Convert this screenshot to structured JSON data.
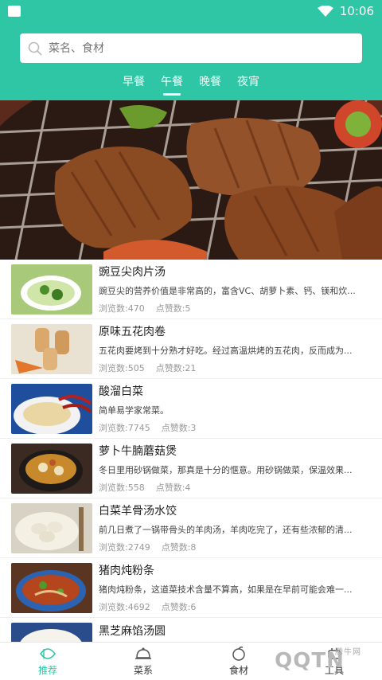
{
  "status": {
    "time": "10:06"
  },
  "search": {
    "placeholder": "菜名、食材"
  },
  "tabs": [
    "早餐",
    "午餐",
    "晚餐",
    "夜宵"
  ],
  "active_tab": "午餐",
  "banner": {
    "image": "grilled-steak-banner"
  },
  "items": [
    {
      "title": "豌豆尖肉片汤",
      "desc": "豌豆尖的营养价值是非常高的，富含VC、胡萝卜素、钙、镁和炊...",
      "views": "浏览数:470",
      "likes": "点赞数:5"
    },
    {
      "title": "原味五花肉卷",
      "desc": "五花肉要烤到十分熟才好吃。经过高温烘烤的五花肉，反而成为...",
      "views": "浏览数:505",
      "likes": "点赞数:21"
    },
    {
      "title": "酸溜白菜",
      "desc": "简单易学家常菜。",
      "views": "浏览数:7745",
      "likes": "点赞数:3"
    },
    {
      "title": "萝卜牛腩蘑菇煲",
      "desc": "冬日里用砂锅做菜，那真是十分的惬意。用砂锅做菜，保温效果...",
      "views": "浏览数:558",
      "likes": "点赞数:4"
    },
    {
      "title": "白菜羊骨汤水饺",
      "desc": "前几日煮了一锅带骨头的羊肉汤，羊肉吃完了，还有些浓郁的清...",
      "views": "浏览数:2749",
      "likes": "点赞数:8"
    },
    {
      "title": "猪肉炖粉条",
      "desc": "猪肉炖粉条，这道菜技术含量不算高，如果是在早前可能会难一...",
      "views": "浏览数:4692",
      "likes": "点赞数:6"
    },
    {
      "title": "黑芝麻馅汤圆",
      "desc": "",
      "views": "",
      "likes": ""
    }
  ],
  "nav": [
    "推荐",
    "菜系",
    "食材",
    "工具"
  ],
  "watermark": {
    "logo": "QQTN",
    "sub": "腾牛网"
  },
  "colors": {
    "accent": "#2fc6a6"
  }
}
